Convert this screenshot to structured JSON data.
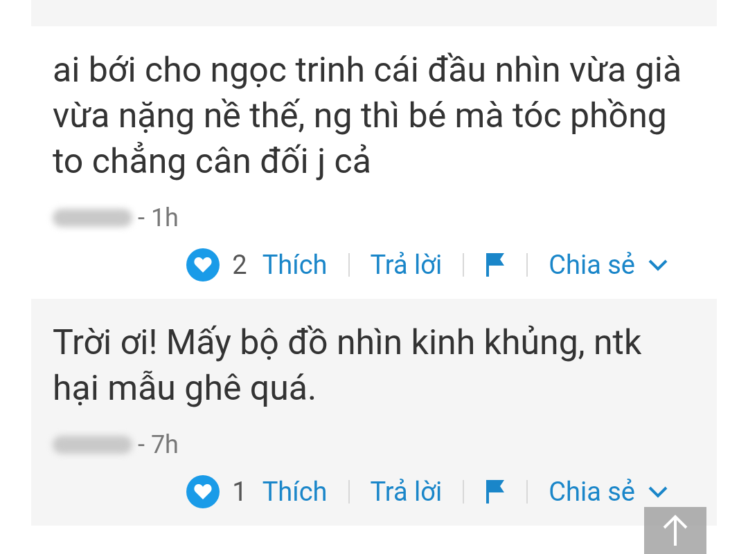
{
  "comments": [
    {
      "text": "ai bới cho ngọc trinh cái đầu nhìn vừa già vừa nặng nề thế, ng thì bé mà tóc phồng to chẳng cân đối j cả",
      "time": "- 1h",
      "likes": "2",
      "like_label": "Thích",
      "reply_label": "Trả lời",
      "share_label": "Chia sẻ"
    },
    {
      "text": "Trời ơi! Mấy bộ đồ nhìn kinh khủng, ntk hại mẫu ghê quá.",
      "time": "- 7h",
      "likes": "1",
      "like_label": "Thích",
      "reply_label": "Trả lời",
      "share_label": "Chia sẻ"
    }
  ]
}
